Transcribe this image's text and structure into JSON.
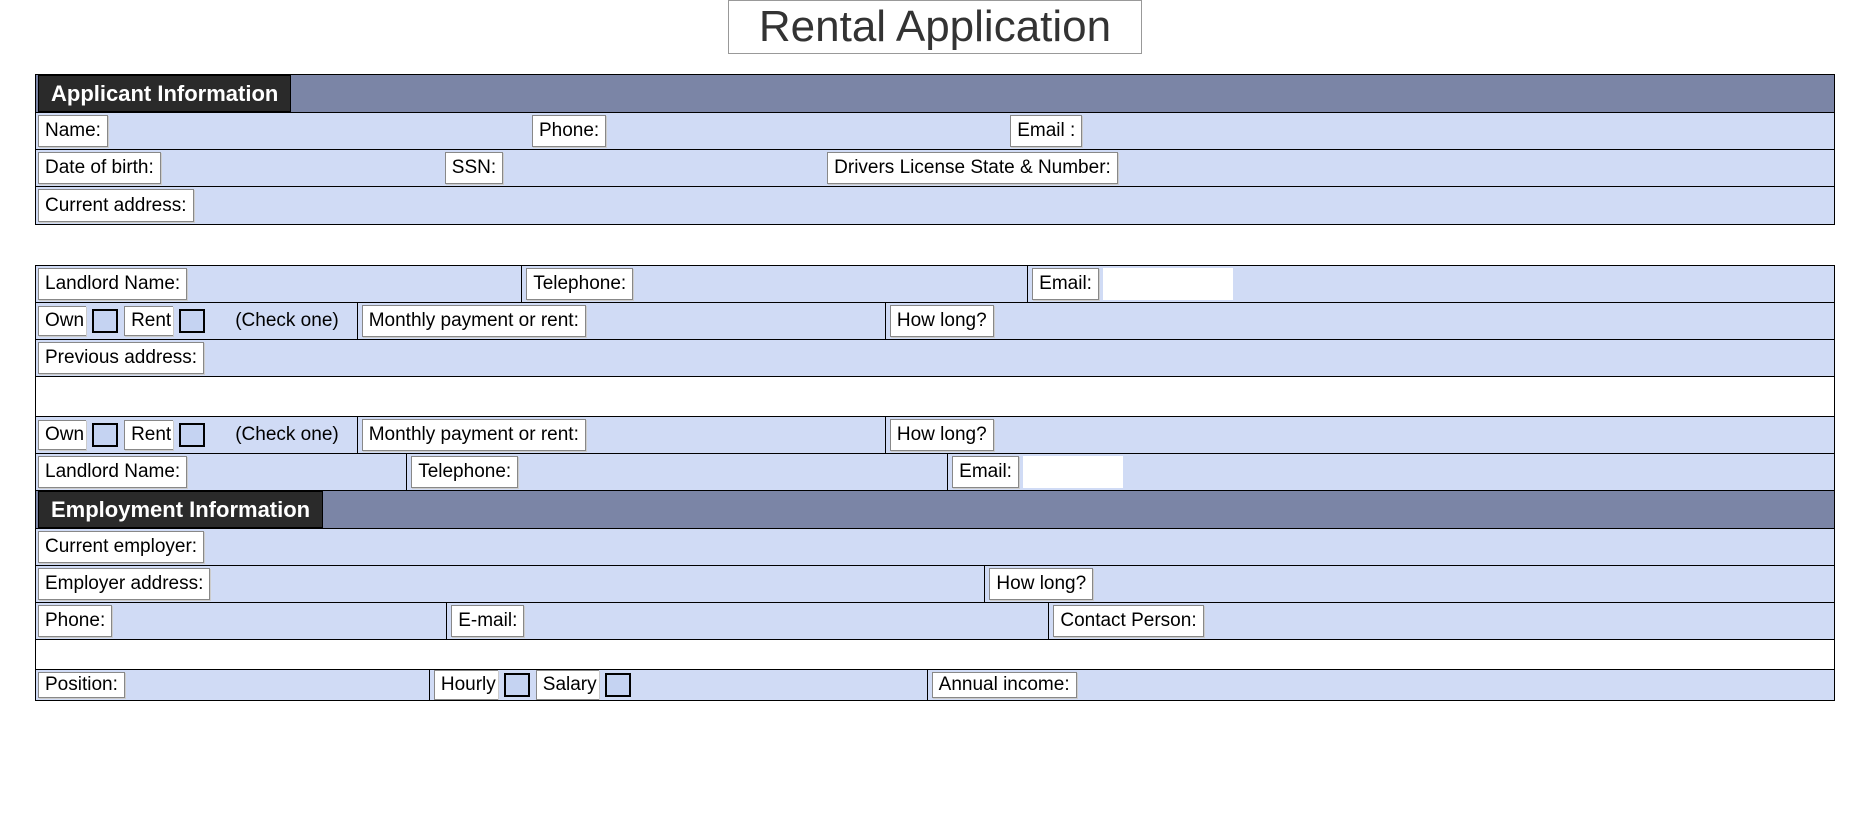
{
  "title": "Rental Application",
  "s1": {
    "header": "Applicant Information",
    "name": "Name:",
    "phone": "Phone:",
    "email": "Email :",
    "dob": "Date of birth:",
    "ssn": "SSN:",
    "dl": "Drivers License State & Number:",
    "curaddr": "Current address:"
  },
  "s2": {
    "landlord": "Landlord Name:",
    "tel": "Telephone:",
    "email": "Email:",
    "own": "Own",
    "rent": "Rent",
    "checkone": "(Check one)",
    "monthly": "Monthly payment or rent:",
    "howlong": "How long?",
    "prevaddr": "Previous address:"
  },
  "s3": {
    "header": "Employment Information",
    "cur": "Current employer:",
    "addr": "Employer address:",
    "howlong": "How long?",
    "phone": "Phone:",
    "email": "E-mail:",
    "contact": "Contact Person:",
    "position": "Position:",
    "hourly": "Hourly",
    "salary": "Salary",
    "annual": "Annual income:"
  }
}
